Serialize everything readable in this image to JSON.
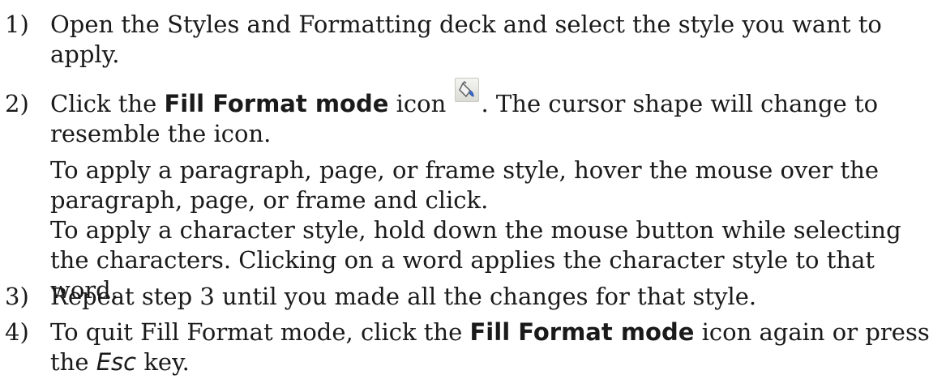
{
  "steps": [
    {
      "number": "1)",
      "line1": "Open the Styles and Formatting deck and select the style you want to",
      "line2": "apply."
    },
    {
      "number": "2)",
      "pre": "Click the ",
      "bold": "Fill Format mode",
      "mid": " icon ",
      "post": ". The cursor shape will change to",
      "line2": "resemble the icon.",
      "icon": "paint-bucket-icon",
      "sub1_line1": "To apply a paragraph, page, or frame style, hover the mouse over the",
      "sub1_line2": "paragraph, page, or frame and click.",
      "sub2_line1": "To apply a character style, hold down the mouse button while selecting",
      "sub2_line2": "the characters. Clicking on a word applies the character style to that",
      "sub2_line3": "word."
    },
    {
      "number": "3)",
      "line1": "Repeat step 3 until you made all the changes for that style."
    },
    {
      "number": "4)",
      "pre": "To quit Fill Format mode, click the ",
      "bold": "Fill Format mode",
      "post": " icon again or press",
      "line2_pre": "the ",
      "line2_italic": "Esc",
      "line2_post": " key."
    }
  ]
}
